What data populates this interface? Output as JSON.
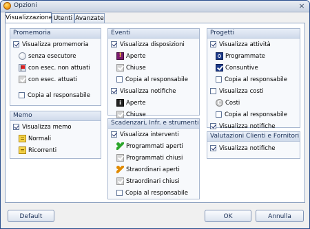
{
  "window": {
    "title": "Opzioni",
    "close": "×"
  },
  "tabs": [
    {
      "label": "Visualizzazione"
    },
    {
      "label": "Utenti"
    },
    {
      "label": "Avanzate"
    }
  ],
  "promemoria": {
    "title": "Promemoria",
    "show": {
      "label": "Visualizza promemoria",
      "checked": true
    },
    "items": [
      {
        "label": "senza esecutore",
        "icon": "white-circle-icon"
      },
      {
        "label": "con esec. non attuati",
        "icon": "red-flag-icon"
      },
      {
        "label": "con esec. attuati",
        "icon": "grey-check-icon"
      }
    ],
    "copy": {
      "label": "Copia al responsabile",
      "checked": false
    }
  },
  "memo": {
    "title": "Memo",
    "show": {
      "label": "Visualizza memo",
      "checked": true
    },
    "items": [
      {
        "label": "Normali",
        "icon": "yellow-note-icon"
      },
      {
        "label": "Ricorrenti",
        "icon": "yellow-note-icon"
      }
    ]
  },
  "eventi": {
    "title": "Eventi",
    "show_disp": {
      "label": "Visualizza disposizioni",
      "checked": true
    },
    "disp_items": [
      {
        "label": "Aperte",
        "icon": "exclamation-icon"
      },
      {
        "label": "Chiuse",
        "icon": "grey-check-icon"
      }
    ],
    "copy": {
      "label": "Copia al responsabile",
      "checked": false
    },
    "show_notif": {
      "label": "Visualizza notifiche",
      "checked": true
    },
    "notif_items": [
      {
        "label": "Aperte",
        "icon": "info-icon"
      },
      {
        "label": "Chiuse",
        "icon": "grey-check-icon"
      }
    ]
  },
  "scadenzari": {
    "title": "Scadenzari, Infr. e strumenti",
    "show": {
      "label": "Visualizza interventi",
      "checked": true
    },
    "items": [
      {
        "label": "Programmati aperti",
        "icon": "green-wrench-icon"
      },
      {
        "label": "Programmati chiusi",
        "icon": "grey-check-icon"
      },
      {
        "label": "Straordinari aperti",
        "icon": "orange-wrench-icon"
      },
      {
        "label": "Straordinari chiusi",
        "icon": "grey-check-icon"
      }
    ],
    "copy": {
      "label": "Copia al responsabile",
      "checked": false
    }
  },
  "progetti": {
    "title": "Progetti",
    "show_att": {
      "label": "Visualizza attività",
      "checked": true
    },
    "att_items": [
      {
        "label": "Programmate",
        "icon": "target-icon"
      },
      {
        "label": "Consuntive",
        "icon": "blue-check-icon"
      }
    ],
    "copy1": {
      "label": "Copia al responsabile",
      "checked": false
    },
    "show_costi": {
      "label": "Visualizza costi",
      "checked": false
    },
    "costi_items": [
      {
        "label": "Costi",
        "icon": "copyright-icon"
      }
    ],
    "copy2": {
      "label": "Copia al responsabile",
      "checked": false
    },
    "show_notif": {
      "label": "Visualizza notifiche",
      "checked": true
    }
  },
  "valutazioni": {
    "title": "Valutazioni Clienti e Fornitori",
    "show_notif": {
      "label": "Visualizza notifiche",
      "checked": true
    }
  },
  "buttons": {
    "default": "Default",
    "ok": "OK",
    "cancel": "Annulla"
  },
  "colors": {
    "accent": "#1a2f55",
    "border": "#8fa3c2",
    "groupHeader": "#cfdaeb"
  }
}
